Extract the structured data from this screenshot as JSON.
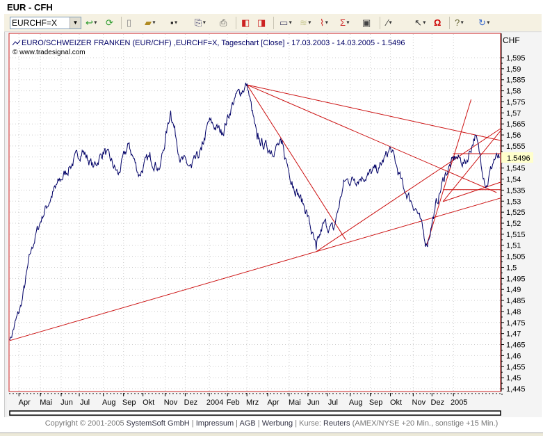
{
  "window": {
    "title": "EUR - CFH"
  },
  "toolbar": {
    "symbol": "EURCHF=X",
    "icons": [
      "refresh-go-icon",
      "reload-icon",
      "new-doc-icon",
      "open-folder-icon",
      "save-icon",
      "copy-icon",
      "print-icon",
      "scroll-left-icon",
      "scroll-right-icon",
      "window-icon",
      "chart-type-icon",
      "indicator-icon",
      "sum-indicator-icon",
      "properties-icon",
      "draw-line-icon",
      "pointer-icon",
      "magnet-icon",
      "help-icon",
      "undo-icon"
    ]
  },
  "chart": {
    "header": "EURO/SCHWEIZER FRANKEN (EUR/CHF) ,EURCHF=X, Tageschart [Close] - 17.03.2003 - 14.03.2005 - 1.5496",
    "source": "© www.tradesignal.com",
    "currency": "CHF",
    "last_value": "1.5496"
  },
  "chart_data": {
    "type": "line",
    "title": "EURO/SCHWEIZER FRANKEN (EUR/CHF) ,EURCHF=X, Tageschart [Close] - 17.03.2003 - 14.03.2005 - 1.5496",
    "x_unit": "days since 17.03.2003",
    "xlim": [
      0,
      732
    ],
    "ylim": [
      1.445,
      1.595
    ],
    "y_ticks": [
      "1,595",
      "1,59",
      "1,585",
      "1,58",
      "1,575",
      "1,57",
      "1,565",
      "1,56",
      "1,555",
      "1,55",
      "1,545",
      "1,54",
      "1,535",
      "1,53",
      "1,525",
      "1,52",
      "1,515",
      "1,51",
      "1,505",
      "1,5",
      "1,495",
      "1,49",
      "1,485",
      "1,48",
      "1,475",
      "1,47",
      "1,465",
      "1,46",
      "1,455",
      "1,45",
      "1,445"
    ],
    "x_ticks": [
      {
        "label": "Apr",
        "day": 22
      },
      {
        "label": "Mai",
        "day": 54
      },
      {
        "label": "Jun",
        "day": 85
      },
      {
        "label": "Jul",
        "day": 112
      },
      {
        "label": "Aug",
        "day": 148
      },
      {
        "label": "Sep",
        "day": 178
      },
      {
        "label": "Okt",
        "day": 207
      },
      {
        "label": "Nov",
        "day": 240
      },
      {
        "label": "Dez",
        "day": 270
      },
      {
        "label": "2004",
        "day": 306
      },
      {
        "label": "Feb",
        "day": 333
      },
      {
        "label": "Mrz",
        "day": 362
      },
      {
        "label": "Apr",
        "day": 393
      },
      {
        "label": "Mai",
        "day": 425
      },
      {
        "label": "Jun",
        "day": 453
      },
      {
        "label": "Jul",
        "day": 482
      },
      {
        "label": "Aug",
        "day": 516
      },
      {
        "label": "Sep",
        "day": 546
      },
      {
        "label": "Okt",
        "day": 576
      },
      {
        "label": "Nov",
        "day": 610
      },
      {
        "label": "Dez",
        "day": 638
      },
      {
        "label": "2005",
        "day": 670
      }
    ],
    "series": [
      {
        "name": "EUR/CHF Close",
        "color": "#000066",
        "days": [
          0,
          17,
          32,
          48,
          68,
          89,
          108,
          125,
          141,
          162,
          177,
          193,
          208,
          224,
          240,
          255,
          271,
          286,
          297,
          317,
          336,
          354,
          369,
          390,
          405,
          421,
          442,
          457,
          468,
          483,
          499,
          514,
          535,
          551,
          568,
          587,
          607,
          622,
          634,
          649,
          665,
          680,
          694,
          711,
          722,
          730
        ],
        "values": [
          1.467,
          1.4825,
          1.508,
          1.523,
          1.536,
          1.5455,
          1.553,
          1.5455,
          1.553,
          1.542,
          1.556,
          1.542,
          1.55,
          1.545,
          1.571,
          1.549,
          1.545,
          1.553,
          1.566,
          1.561,
          1.577,
          1.583,
          1.558,
          1.553,
          1.556,
          1.539,
          1.526,
          1.508,
          1.52,
          1.517,
          1.539,
          1.54,
          1.542,
          1.545,
          1.554,
          1.536,
          1.526,
          1.51,
          1.526,
          1.542,
          1.55,
          1.547,
          1.56,
          1.537,
          1.549,
          1.5496
        ]
      }
    ],
    "trendlines": [
      {
        "from": [
          0,
          1.4668
        ],
        "to": [
          732,
          1.5314
        ]
      },
      {
        "from": [
          354,
          1.5827
        ],
        "to": [
          732,
          1.5575
        ]
      },
      {
        "from": [
          354,
          1.5827
        ],
        "to": [
          726,
          1.5339
        ]
      },
      {
        "from": [
          354,
          1.5827
        ],
        "to": [
          501,
          1.5125
        ]
      },
      {
        "from": [
          457,
          1.5071
        ],
        "to": [
          732,
          1.5629
        ]
      },
      {
        "from": [
          622,
          1.5103
        ],
        "to": [
          688,
          1.5761
        ]
      },
      {
        "from": [
          646,
          1.5298
        ],
        "to": [
          732,
          1.5619
        ]
      },
      {
        "from": [
          646,
          1.5298
        ],
        "to": [
          732,
          1.5386
        ]
      },
      {
        "from": [
          646,
          1.5352
        ],
        "to": [
          732,
          1.5352
        ]
      },
      {
        "from": [
          661,
          1.5515
        ],
        "to": [
          732,
          1.5515
        ]
      }
    ],
    "trendline_color": "#cc1111",
    "grid": true
  },
  "footer": {
    "copyright": "Copyright © 2001-2005 ",
    "company": "SystemSoft GmbH",
    "sep": " | ",
    "impressum": "Impressum",
    "agb": "AGB",
    "werbung": "Werbung",
    "kurse_label": "Kurse: ",
    "reuters": "Reuters",
    "delay": " (AMEX/NYSE +20 Min., sonstige +15 Min.)"
  }
}
